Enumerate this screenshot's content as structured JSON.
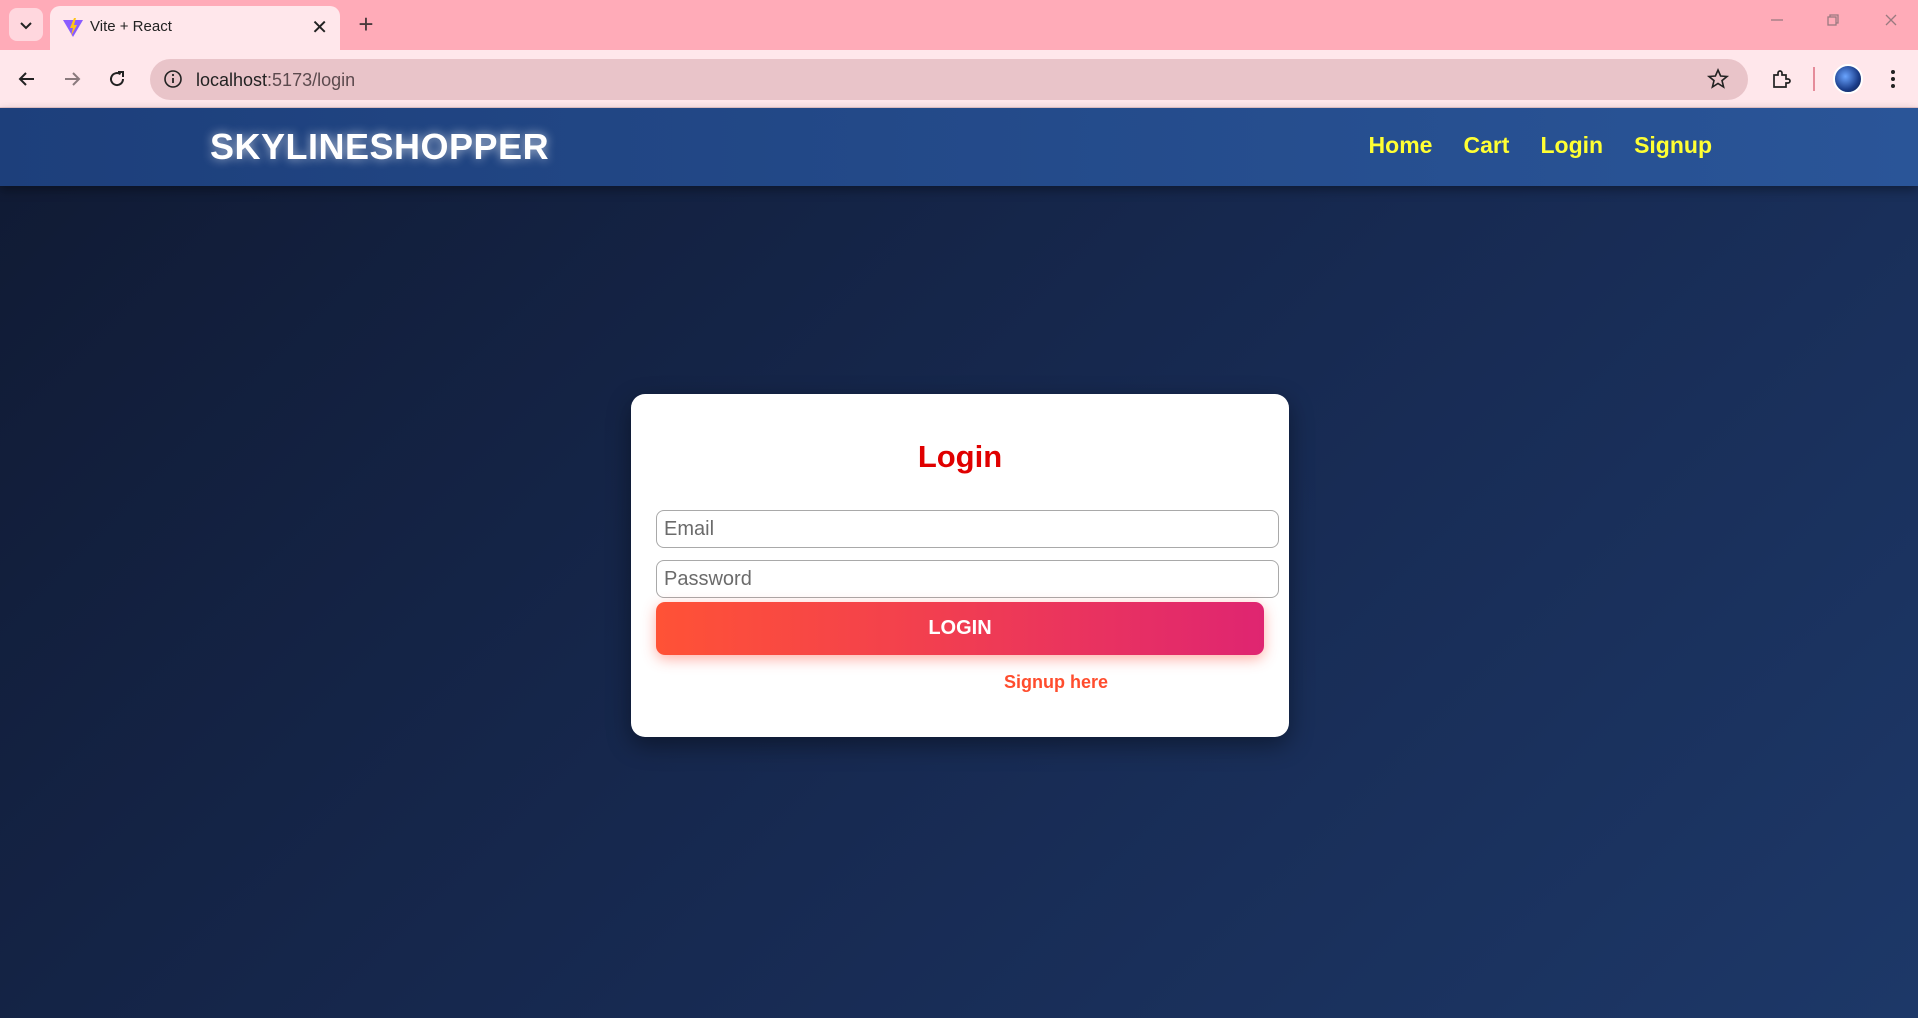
{
  "browser": {
    "tab_title": "Vite + React",
    "new_tab_symbol": "+",
    "close_symbol": "✕",
    "url_host": "localhost",
    "url_path": ":5173/login"
  },
  "navbar": {
    "brand": "SKYLINESHOPPER",
    "links": [
      "Home",
      "Cart",
      "Login",
      "Signup"
    ],
    "link_color": "#ffff33"
  },
  "login_form": {
    "title": "Login",
    "email_placeholder": "Email",
    "password_placeholder": "Password",
    "submit_label": "LOGIN",
    "signup_link": "Signup here"
  },
  "colors": {
    "accent_red": "#e00000",
    "button_gradient_start": "#ff5236",
    "button_gradient_end": "#df2571",
    "chrome_pink": "#ffabb8"
  }
}
